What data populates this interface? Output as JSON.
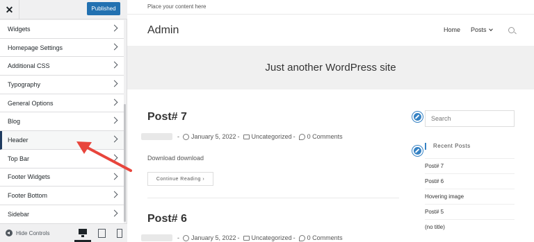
{
  "customizer": {
    "close_label": "✕",
    "publish_label": "Published",
    "menu": [
      {
        "label": "Widgets"
      },
      {
        "label": "Homepage Settings"
      },
      {
        "label": "Additional CSS"
      },
      {
        "label": "Typography"
      },
      {
        "label": "General Options"
      },
      {
        "label": "Blog"
      },
      {
        "label": "Header"
      },
      {
        "label": "Top Bar"
      },
      {
        "label": "Footer Widgets"
      },
      {
        "label": "Footer Bottom"
      },
      {
        "label": "Sidebar"
      }
    ],
    "active_item": "Header",
    "hide_controls_label": "Hide Controls"
  },
  "preview": {
    "topbar_text": "Place your content here",
    "site_title": "Admin",
    "nav": [
      {
        "label": "Home"
      },
      {
        "label": "Posts"
      }
    ],
    "tagline": "Just another WordPress site",
    "posts": [
      {
        "title": "Post# 7",
        "date": "January 5, 2022",
        "category": "Uncategorized",
        "comments": "0 Comments",
        "excerpt": "Download download",
        "read_more": "Continue Reading"
      },
      {
        "title": "Post# 6",
        "date": "January 5, 2022",
        "category": "Uncategorized",
        "comments": "0 Comments"
      }
    ],
    "sidebar": {
      "search_placeholder": "Search",
      "recent_title": "Recent Posts",
      "recent": [
        "Post# 7",
        "Post# 6",
        "Hovering image",
        "Post# 5",
        "(no title)"
      ]
    }
  },
  "colors": {
    "accent": "#2271b1",
    "arrow": "#e8453c",
    "active_border": "#1e3a5f",
    "edit_badge": "#3582c4"
  }
}
